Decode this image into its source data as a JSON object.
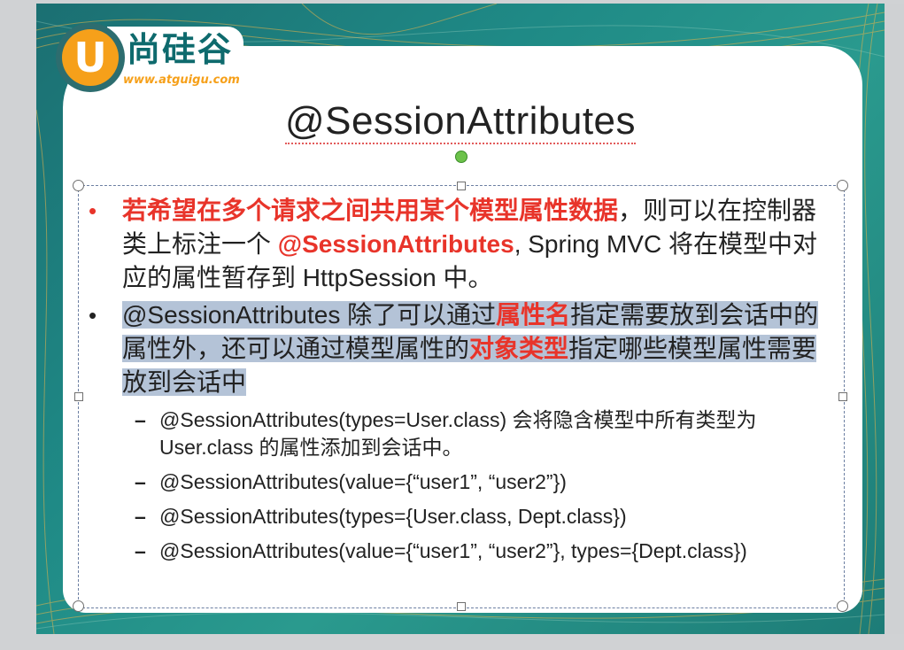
{
  "logo": {
    "badge_letter": "U",
    "brand": "尚硅谷",
    "url": "www.atguigu.com"
  },
  "slide": {
    "title": "@SessionAttributes",
    "bullets": [
      {
        "marker": "•",
        "part1_red": "若希望在多个请求之间共用某个模型属性数据",
        "part2": "，则可以在控制器类上标注一个 ",
        "part3_red": "@SessionAttributes",
        "part4": ", Spring MVC 将在模型中对应的属性暂存到 HttpSession 中。"
      },
      {
        "marker": "•",
        "part1": "@SessionAttributes 除了可以通过",
        "part2_red": "属性名",
        "part3": "指定需要放到会话中的属性外，还可以通过模型属性的",
        "part4_red": "对象类型",
        "part5": "指定哪些模型属性需要放到会话中"
      }
    ],
    "sub_items": [
      {
        "marker": "–",
        "text": "@SessionAttributes(types=User.class) 会将隐含模型中所有类型为 User.class 的属性添加到会话中。"
      },
      {
        "marker": "–",
        "text": "@SessionAttributes(value={“user1”, “user2”})"
      },
      {
        "marker": "–",
        "text": "@SessionAttributes(types={User.class, Dept.class})"
      },
      {
        "marker": "–",
        "text": "@SessionAttributes(value={“user1”, “user2”}, types={Dept.class})"
      }
    ]
  },
  "colors": {
    "accent_red": "#e8342a",
    "highlight": "#b4c3d7",
    "teal": "#1f8a86",
    "brand_orange": "#f6a01a"
  }
}
